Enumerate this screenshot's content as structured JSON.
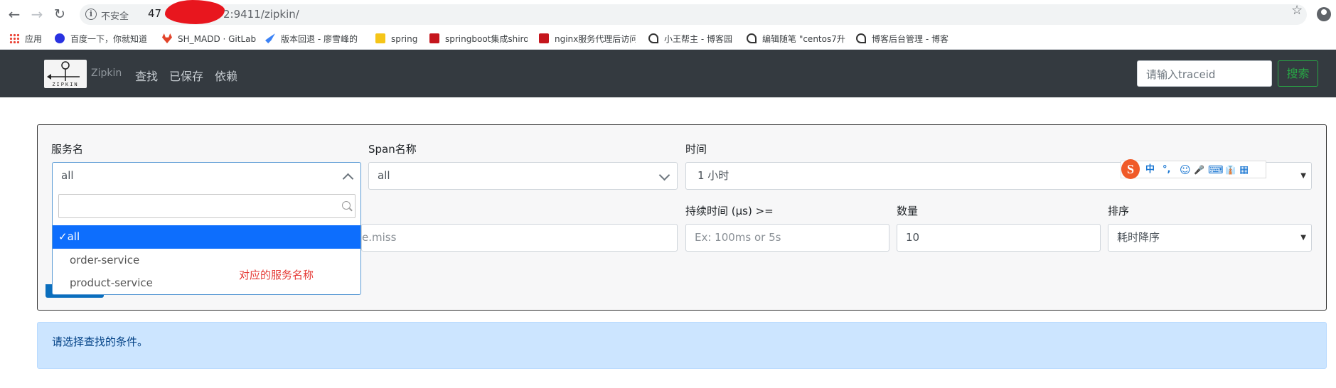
{
  "browser": {
    "security_label": "不安全",
    "separator": "|",
    "url_prefix": "47",
    "url_suffix": "2:9411/zipkin/",
    "bookmarks": [
      {
        "label": "应用",
        "icon": "apps-grid-icon",
        "color": "#ea4335"
      },
      {
        "label": "百度一下，你就知道",
        "icon": "baidu-paw-icon",
        "color": "#2932e1"
      },
      {
        "label": "SH_MADD · GitLab",
        "icon": "gitlab-icon",
        "color": "#e24329"
      },
      {
        "label": "版本回退 - 廖雪峰的",
        "icon": "rocket-icon",
        "color": "#3b82f6"
      },
      {
        "label": "spring",
        "icon": "folder-icon",
        "color": "#f5c518"
      },
      {
        "label": "springboot集成shiro",
        "icon": "csdn-icon",
        "color": "#c5161d"
      },
      {
        "label": "nginx服务代理后访问",
        "icon": "csdn-icon",
        "color": "#c5161d"
      },
      {
        "label": "小王帮主 - 博客园",
        "icon": "cnblogs-icon",
        "color": "#333333"
      },
      {
        "label": "编辑随笔 \"centos7升",
        "icon": "cnblogs-icon",
        "color": "#333333"
      },
      {
        "label": "博客后台管理 - 博客",
        "icon": "cnblogs-icon",
        "color": "#333333"
      }
    ]
  },
  "navbar": {
    "logo_text": "ZIPKIN",
    "brand": "Zipkin",
    "links": [
      "查找",
      "已保存",
      "依赖"
    ],
    "traceid_placeholder": "请输入traceid",
    "search_button": "搜索"
  },
  "form": {
    "service_label": "服务名",
    "service_value": "all",
    "span_label": "Span名称",
    "span_value": "all",
    "time_label": "时间",
    "time_value": "1 小时",
    "tags_placeholder_tail": "e.miss",
    "duration_label": "持续时间 (μs) >=",
    "duration_placeholder": "Ex: 100ms or 5s",
    "limit_label": "数量",
    "limit_value": "10",
    "sort_label": "排序",
    "sort_value": "耗时降序"
  },
  "dropdown": {
    "items": [
      {
        "label": "all",
        "selected": true
      },
      {
        "label": "order-service",
        "selected": false
      },
      {
        "label": "product-service",
        "selected": false
      }
    ],
    "annotation": "对应的服务名称"
  },
  "ime": {
    "logo": "S",
    "items": [
      "中",
      "°,",
      "☺",
      "🎤",
      "⌨",
      "👔",
      "▦"
    ]
  },
  "alert": {
    "message": "请选择查找的条件。"
  }
}
